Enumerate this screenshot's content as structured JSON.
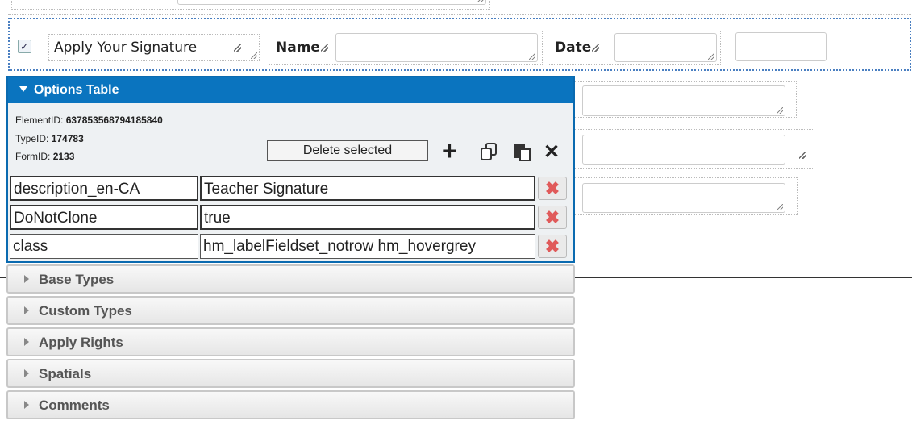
{
  "signature_row": {
    "checkbox_checked": true,
    "label": "Apply Your Signature",
    "name_label": "Name",
    "date_label": "Date"
  },
  "options_table": {
    "header": "Options Table",
    "element_id_label": "ElementID:",
    "element_id": "637853568794185840",
    "type_id_label": "TypeID:",
    "type_id": "174783",
    "form_id_label": "FormID:",
    "form_id": "2133",
    "delete_selected_label": "Delete selected",
    "rows": [
      {
        "key": "description_en-CA",
        "value": "Teacher Signature"
      },
      {
        "key": "DoNotClone",
        "value": "true"
      },
      {
        "key": "class",
        "value": "hm_labelFieldset_notrow hm_hovergrey"
      }
    ]
  },
  "accordion": [
    {
      "label": "Base Types"
    },
    {
      "label": "Custom Types"
    },
    {
      "label": "Apply Rights"
    },
    {
      "label": "Spatials"
    },
    {
      "label": "Comments"
    }
  ],
  "icons": {
    "add": "plus-icon",
    "copy": "copy-icon",
    "paste": "paste-icon",
    "close": "close-icon",
    "delete_row": "delete-row-icon"
  },
  "colors": {
    "header_blue": "#0a74bf",
    "dotted_border": "#4a7fc1",
    "delete_red": "#e05a5a"
  }
}
